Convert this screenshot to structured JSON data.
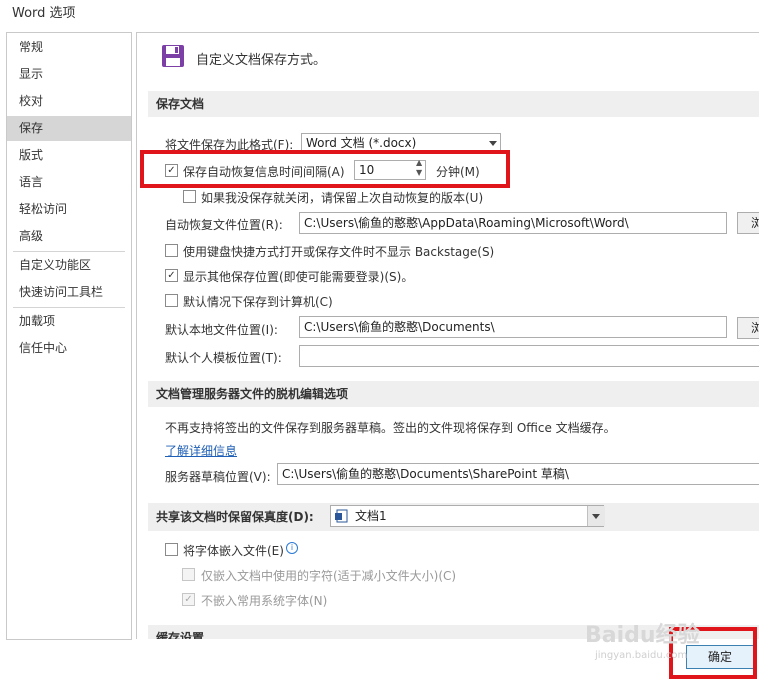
{
  "window": {
    "title": "Word 选项"
  },
  "nav": {
    "items": [
      {
        "label": "常规"
      },
      {
        "label": "显示"
      },
      {
        "label": "校对"
      },
      {
        "label": "保存"
      },
      {
        "label": "版式"
      },
      {
        "label": "语言"
      },
      {
        "label": "轻松访问"
      },
      {
        "label": "高级"
      },
      {
        "label": "自定义功能区"
      },
      {
        "label": "快速访问工具栏"
      },
      {
        "label": "加载项"
      },
      {
        "label": "信任中心"
      }
    ]
  },
  "header": {
    "text": "自定义文档保存方式。",
    "icon": "save-icon"
  },
  "save_docs": {
    "section_title": "保存文档",
    "format_label": "将文件保存为此格式(F):",
    "format_value": "Word 文档 (*.docx)",
    "autorecover_label": "保存自动恢复信息时间间隔(A)",
    "autorecover_checked": true,
    "autorecover_minutes": "10",
    "minutes_label": "分钟(M)",
    "keep_last_label": "如果我没保存就关闭，请保留上次自动恢复的版本(U)",
    "keep_last_checked": false,
    "autorecover_location_label": "自动恢复文件位置(R):",
    "autorecover_location_value": "C:\\Users\\偷鱼的憨憨\\AppData\\Roaming\\Microsoft\\Word\\",
    "browse_label": "浏",
    "no_backstage_label": "使用键盘快捷方式打开或保存文件时不显示 Backstage(S)",
    "no_backstage_checked": false,
    "show_other_locations_label": "显示其他保存位置(即使可能需要登录)(S)。",
    "show_other_locations_checked": true,
    "default_computer_label": "默认情况下保存到计算机(C)",
    "default_computer_checked": false,
    "default_local_label": "默认本地文件位置(I):",
    "default_local_value": "C:\\Users\\偷鱼的憨憨\\Documents\\",
    "browse2_label": "浏",
    "default_template_label": "默认个人模板位置(T):",
    "default_template_value": ""
  },
  "offline": {
    "section_title": "文档管理服务器文件的脱机编辑选项",
    "note": "不再支持将签出的文件保存到服务器草稿。签出的文件现将保存到 Office 文档缓存。",
    "learn_more": "了解详细信息",
    "drafts_label": "服务器草稿位置(V):",
    "drafts_value": "C:\\Users\\偷鱼的憨憨\\Documents\\SharePoint 草稿\\"
  },
  "fidelity": {
    "section_title": "共享该文档时保留保真度(D):",
    "doc_value": "文档1",
    "embed_fonts_label": "将字体嵌入文件(E)",
    "embed_fonts_checked": false,
    "only_used_chars_label": "仅嵌入文档中使用的字符(适于减小文件大小)(C)",
    "no_common_fonts_label": "不嵌入常用系统字体(N)",
    "info_icon": "info-icon"
  },
  "cache": {
    "section_title": "缓存设置"
  },
  "footer": {
    "ok_label": "确定"
  },
  "watermark": {
    "brand": "Baidu经验",
    "url": "jingyan.baidu.com"
  },
  "colors": {
    "highlight": "#e0141b",
    "selected_nav": "#d6d6d6",
    "section_bg": "#efefef",
    "link": "#1f5fb5"
  }
}
